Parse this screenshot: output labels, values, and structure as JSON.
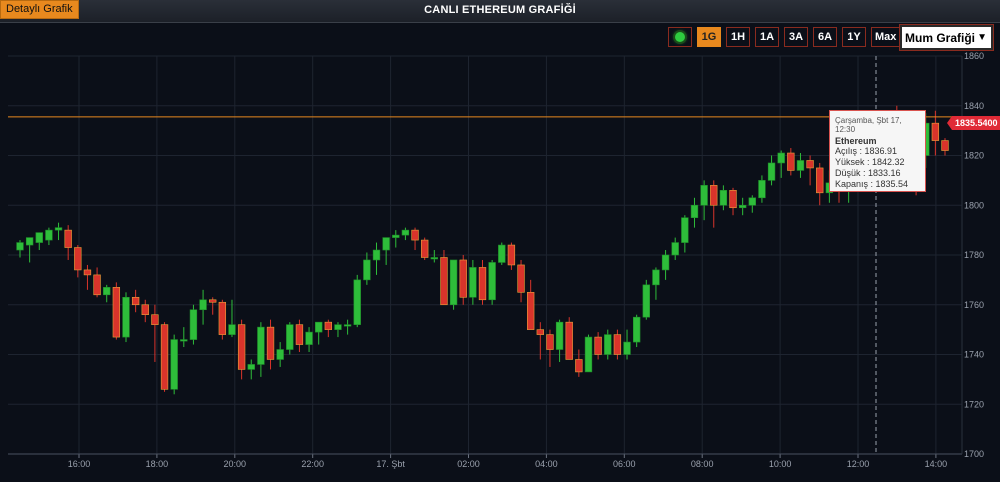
{
  "header": {
    "detail_button": "Detaylı Grafik",
    "title": "CANLI ETHEREUM GRAFİĞİ"
  },
  "toolbar": {
    "live_icon": "green-dot-icon",
    "buttons": [
      "1G",
      "1H",
      "1A",
      "3A",
      "6A",
      "1Y",
      "Max"
    ],
    "active": "1G",
    "chart_type": "Mum Grafiği"
  },
  "tooltip": {
    "date": "Çarşamba, Şbt 17, 12:30",
    "name": "Ethereum",
    "open": "Açılış : 1836.91",
    "high": "Yüksek : 1842.32",
    "low": "Düşük : 1833.16",
    "close": "Kapanış : 1835.54"
  },
  "colors": {
    "up": "#2ebd3a",
    "down": "#d9342b",
    "accent": "#e8891e",
    "price_tag": "#e02a36"
  },
  "chart_data": {
    "type": "candlestick",
    "current_price": "1835.5400",
    "y_ticks": [
      1700,
      1720,
      1740,
      1760,
      1780,
      1800,
      1820,
      1840,
      1860
    ],
    "ylim": [
      1700,
      1860
    ],
    "x_ticks": [
      "16:00",
      "18:00",
      "20:00",
      "22:00",
      "17. Şbt",
      "02:00",
      "04:00",
      "06:00",
      "08:00",
      "10:00",
      "12:00",
      "14:00"
    ],
    "grid": true,
    "candles": [
      [
        1782,
        1786,
        1779,
        1785
      ],
      [
        1784,
        1787,
        1777,
        1787
      ],
      [
        1785,
        1789,
        1782,
        1789
      ],
      [
        1786,
        1791,
        1784,
        1790
      ],
      [
        1790,
        1793,
        1786,
        1791
      ],
      [
        1790,
        1792,
        1778,
        1783
      ],
      [
        1783,
        1784,
        1771,
        1774
      ],
      [
        1774,
        1776,
        1766,
        1772
      ],
      [
        1772,
        1775,
        1763,
        1764
      ],
      [
        1764,
        1768,
        1761,
        1767
      ],
      [
        1767,
        1769,
        1746,
        1747
      ],
      [
        1747,
        1765,
        1745,
        1763
      ],
      [
        1763,
        1766,
        1757,
        1760
      ],
      [
        1760,
        1762,
        1753,
        1756
      ],
      [
        1756,
        1760,
        1737,
        1752
      ],
      [
        1752,
        1753,
        1725,
        1726
      ],
      [
        1726,
        1748,
        1724,
        1746
      ],
      [
        1746,
        1751,
        1743,
        1746
      ],
      [
        1746,
        1760,
        1744,
        1758
      ],
      [
        1758,
        1766,
        1752,
        1762
      ],
      [
        1762,
        1763,
        1756,
        1761
      ],
      [
        1761,
        1762,
        1746,
        1748
      ],
      [
        1748,
        1762,
        1747,
        1752
      ],
      [
        1752,
        1754,
        1730,
        1734
      ],
      [
        1734,
        1738,
        1730,
        1736
      ],
      [
        1736,
        1753,
        1731,
        1751
      ],
      [
        1751,
        1754,
        1734,
        1738
      ],
      [
        1738,
        1745,
        1735,
        1742
      ],
      [
        1742,
        1753,
        1740,
        1752
      ],
      [
        1752,
        1754,
        1741,
        1744
      ],
      [
        1744,
        1751,
        1741,
        1749
      ],
      [
        1749,
        1753,
        1744,
        1753
      ],
      [
        1753,
        1754,
        1747,
        1750
      ],
      [
        1750,
        1753,
        1747,
        1752
      ],
      [
        1752,
        1754,
        1748,
        1752
      ],
      [
        1752,
        1772,
        1751,
        1770
      ],
      [
        1770,
        1781,
        1768,
        1778
      ],
      [
        1778,
        1785,
        1772,
        1782
      ],
      [
        1782,
        1786,
        1776,
        1787
      ],
      [
        1787,
        1790,
        1783,
        1788
      ],
      [
        1788,
        1791,
        1786,
        1790
      ],
      [
        1790,
        1791,
        1782,
        1786
      ],
      [
        1786,
        1787,
        1778,
        1779
      ],
      [
        1779,
        1782,
        1777,
        1779
      ],
      [
        1779,
        1782,
        1760,
        1760
      ],
      [
        1760,
        1778,
        1758,
        1778
      ],
      [
        1778,
        1780,
        1760,
        1763
      ],
      [
        1763,
        1778,
        1760,
        1775
      ],
      [
        1775,
        1778,
        1760,
        1762
      ],
      [
        1762,
        1778,
        1760,
        1777
      ],
      [
        1777,
        1785,
        1776,
        1784
      ],
      [
        1784,
        1785,
        1774,
        1776
      ],
      [
        1776,
        1778,
        1761,
        1765
      ],
      [
        1765,
        1770,
        1750,
        1750
      ],
      [
        1750,
        1753,
        1738,
        1748
      ],
      [
        1748,
        1750,
        1735,
        1742
      ],
      [
        1742,
        1754,
        1737,
        1753
      ],
      [
        1753,
        1755,
        1738,
        1738
      ],
      [
        1738,
        1742,
        1731,
        1733
      ],
      [
        1733,
        1748,
        1733,
        1747
      ],
      [
        1747,
        1749,
        1738,
        1740
      ],
      [
        1740,
        1750,
        1738,
        1748
      ],
      [
        1748,
        1750,
        1738,
        1740
      ],
      [
        1740,
        1750,
        1738,
        1745
      ],
      [
        1745,
        1756,
        1743,
        1755
      ],
      [
        1755,
        1770,
        1754,
        1768
      ],
      [
        1768,
        1775,
        1762,
        1774
      ],
      [
        1774,
        1782,
        1770,
        1780
      ],
      [
        1780,
        1787,
        1778,
        1785
      ],
      [
        1785,
        1796,
        1781,
        1795
      ],
      [
        1795,
        1803,
        1791,
        1800
      ],
      [
        1800,
        1810,
        1794,
        1808
      ],
      [
        1808,
        1810,
        1791,
        1800
      ],
      [
        1800,
        1808,
        1798,
        1806
      ],
      [
        1806,
        1807,
        1796,
        1799
      ],
      [
        1799,
        1803,
        1796,
        1800
      ],
      [
        1800,
        1804,
        1797,
        1803
      ],
      [
        1803,
        1812,
        1801,
        1810
      ],
      [
        1810,
        1820,
        1808,
        1817
      ],
      [
        1817,
        1822,
        1811,
        1821
      ],
      [
        1821,
        1823,
        1812,
        1814
      ],
      [
        1814,
        1821,
        1811,
        1818
      ],
      [
        1818,
        1820,
        1808,
        1815
      ],
      [
        1815,
        1817,
        1800,
        1805
      ],
      [
        1805,
        1814,
        1801,
        1809
      ],
      [
        1809,
        1812,
        1801,
        1806
      ],
      [
        1806,
        1813,
        1801,
        1812
      ],
      [
        1812,
        1818,
        1806,
        1815
      ],
      [
        1815,
        1820,
        1806,
        1808
      ],
      [
        1808,
        1822,
        1807,
        1820
      ],
      [
        1820,
        1836,
        1814,
        1834
      ],
      [
        1834,
        1840,
        1818,
        1822
      ],
      [
        1822,
        1830,
        1815,
        1826
      ],
      [
        1826,
        1835,
        1804,
        1820
      ],
      [
        1820,
        1837,
        1815,
        1833
      ],
      [
        1833,
        1838,
        1820,
        1826
      ],
      [
        1826,
        1827,
        1820,
        1822
      ]
    ]
  }
}
